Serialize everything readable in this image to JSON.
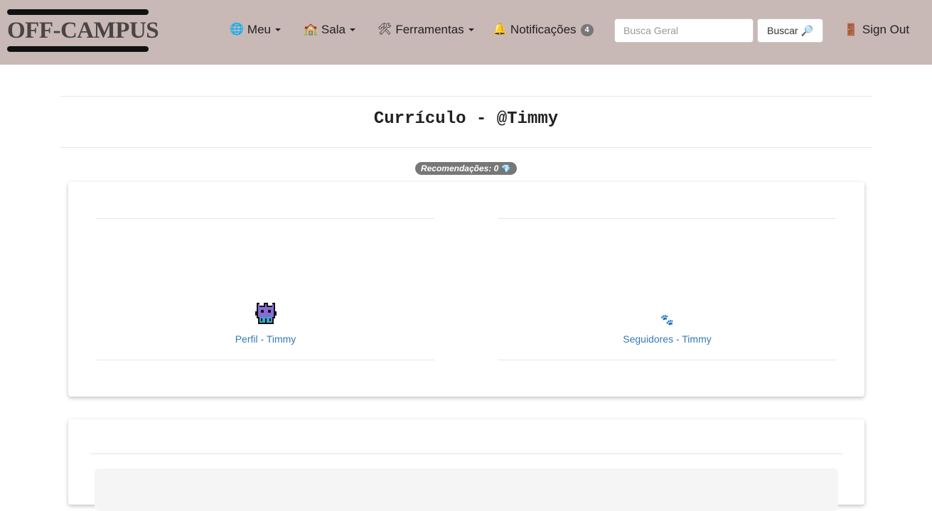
{
  "brand": {
    "logo_text": "OFF-CAMPUS"
  },
  "nav": {
    "meu": {
      "icon": "globe-icon",
      "glyph": "🌐",
      "label": "Meu"
    },
    "sala": {
      "icon": "school-icon",
      "glyph": "🏫",
      "label": "Sala"
    },
    "ferramentas": {
      "icon": "tools-icon",
      "glyph": "🛠",
      "label": "Ferramentas"
    },
    "notificacoes": {
      "icon": "bell-icon",
      "glyph": "🔔",
      "label": "Notificações",
      "count": "4"
    },
    "search": {
      "placeholder": "Busca Geral",
      "button_label": "Buscar",
      "button_glyph": "🔎"
    },
    "signout": {
      "icon": "door-icon",
      "glyph": "🚪",
      "label": "Sign Out"
    }
  },
  "page": {
    "title": "Currículo - @Timmy",
    "recommendations": {
      "label": "Recomendações: 0",
      "glyph": "💎"
    }
  },
  "cards": {
    "profile": {
      "link": "Perfil - Timmy",
      "icon": "monster-avatar-icon"
    },
    "followers": {
      "link": "Seguidores - Timmy",
      "icon": "followers-icon",
      "glyph": "🐾"
    }
  },
  "colors": {
    "navbar": "#c8b8b6",
    "link": "#337ab7",
    "badge": "#777777"
  }
}
